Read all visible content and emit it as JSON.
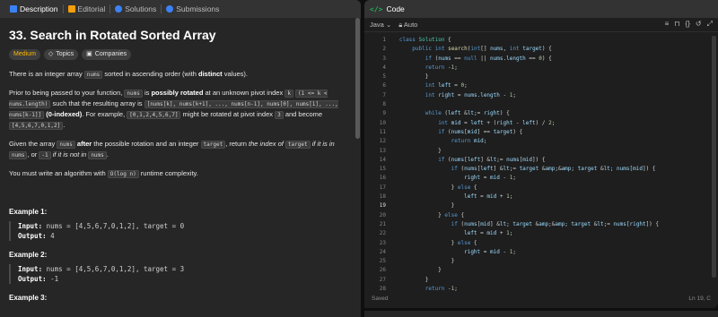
{
  "left": {
    "tabs": [
      {
        "label": "Description"
      },
      {
        "label": "Editorial"
      },
      {
        "label": "Solutions"
      },
      {
        "label": "Submissions"
      }
    ],
    "title": "33. Search in Rotated Sorted Array",
    "tags": {
      "difficulty": "Medium",
      "topics": "Topics",
      "companies": "Companies"
    },
    "p1": {
      "a": "There is an integer array ",
      "code": "nums",
      "b": " sorted in ascending order (with ",
      "bold": "distinct",
      "c": " values)."
    },
    "p2": {
      "a": "Prior to being passed to your function, ",
      "code1": "nums",
      "b": " is ",
      "bold1": "possibly rotated",
      "c": " at an unknown pivot index ",
      "code2": "k",
      "code3": "(1 <= k < nums.length)",
      "d": " such that the resulting array is ",
      "code4": "[nums[k], nums[k+1], ..., nums[n-1], nums[0], nums[1], ..., nums[k-1]]",
      "bold2": "(0-indexed)",
      "e": ". For example, ",
      "code5": "[0,1,2,4,5,6,7]",
      "f": " might be rotated at pivot index ",
      "code6": "3",
      "g": " and become ",
      "code7": "[4,5,6,7,0,1,2]",
      "h": "."
    },
    "p3": {
      "a": "Given the array ",
      "code1": "nums",
      "bold1": "after",
      "b": " the possible rotation and an integer ",
      "code2": "target",
      "c": ", return ",
      "i1": "the index of",
      "code3": "target",
      "i2": "if it is in",
      "code4": "nums",
      "d": ", or ",
      "code5": "-1",
      "i3": "if it is not in",
      "code6": "nums",
      "e": "."
    },
    "p4": {
      "a": "You must write an algorithm with ",
      "code": "O(log n)",
      "b": " runtime complexity."
    },
    "examples": [
      {
        "heading": "Example 1:",
        "input_label": "Input:",
        "input": "nums = [4,5,6,7,0,1,2], target = 0",
        "output_label": "Output:",
        "output": "4"
      },
      {
        "heading": "Example 2:",
        "input_label": "Input:",
        "input": "nums = [4,5,6,7,0,1,2], target = 3",
        "output_label": "Output:",
        "output": "-1"
      },
      {
        "heading": "Example 3:"
      }
    ]
  },
  "right": {
    "header": "Code",
    "language": "Java",
    "mode": "Auto",
    "status_left": "Saved",
    "status_right": "Ln 19, C",
    "current_line": 19,
    "lines": [
      "class Solution {",
      "    public int search(int[] nums, int target) {",
      "        if (nums == null || nums.length == 0) {",
      "        return -1;",
      "        }",
      "        int left = 0;",
      "        int right = nums.length - 1;",
      "",
      "        while (left <= right) {",
      "            int mid = left + (right - left) / 2;",
      "            if (nums[mid] == target) {",
      "                return mid;",
      "            }",
      "            if (nums[left] <= nums[mid]) {",
      "                if (nums[left] <= target && target < nums[mid]) {",
      "                    right = mid - 1;",
      "                } else {",
      "                    left = mid + 1;",
      "                }",
      "            } else {",
      "                if (nums[mid] < target && target <= nums[right]) {",
      "                    left = mid + 1;",
      "                } else {",
      "                    right = mid - 1;",
      "                }",
      "            }",
      "        }",
      "        return -1;"
    ]
  }
}
